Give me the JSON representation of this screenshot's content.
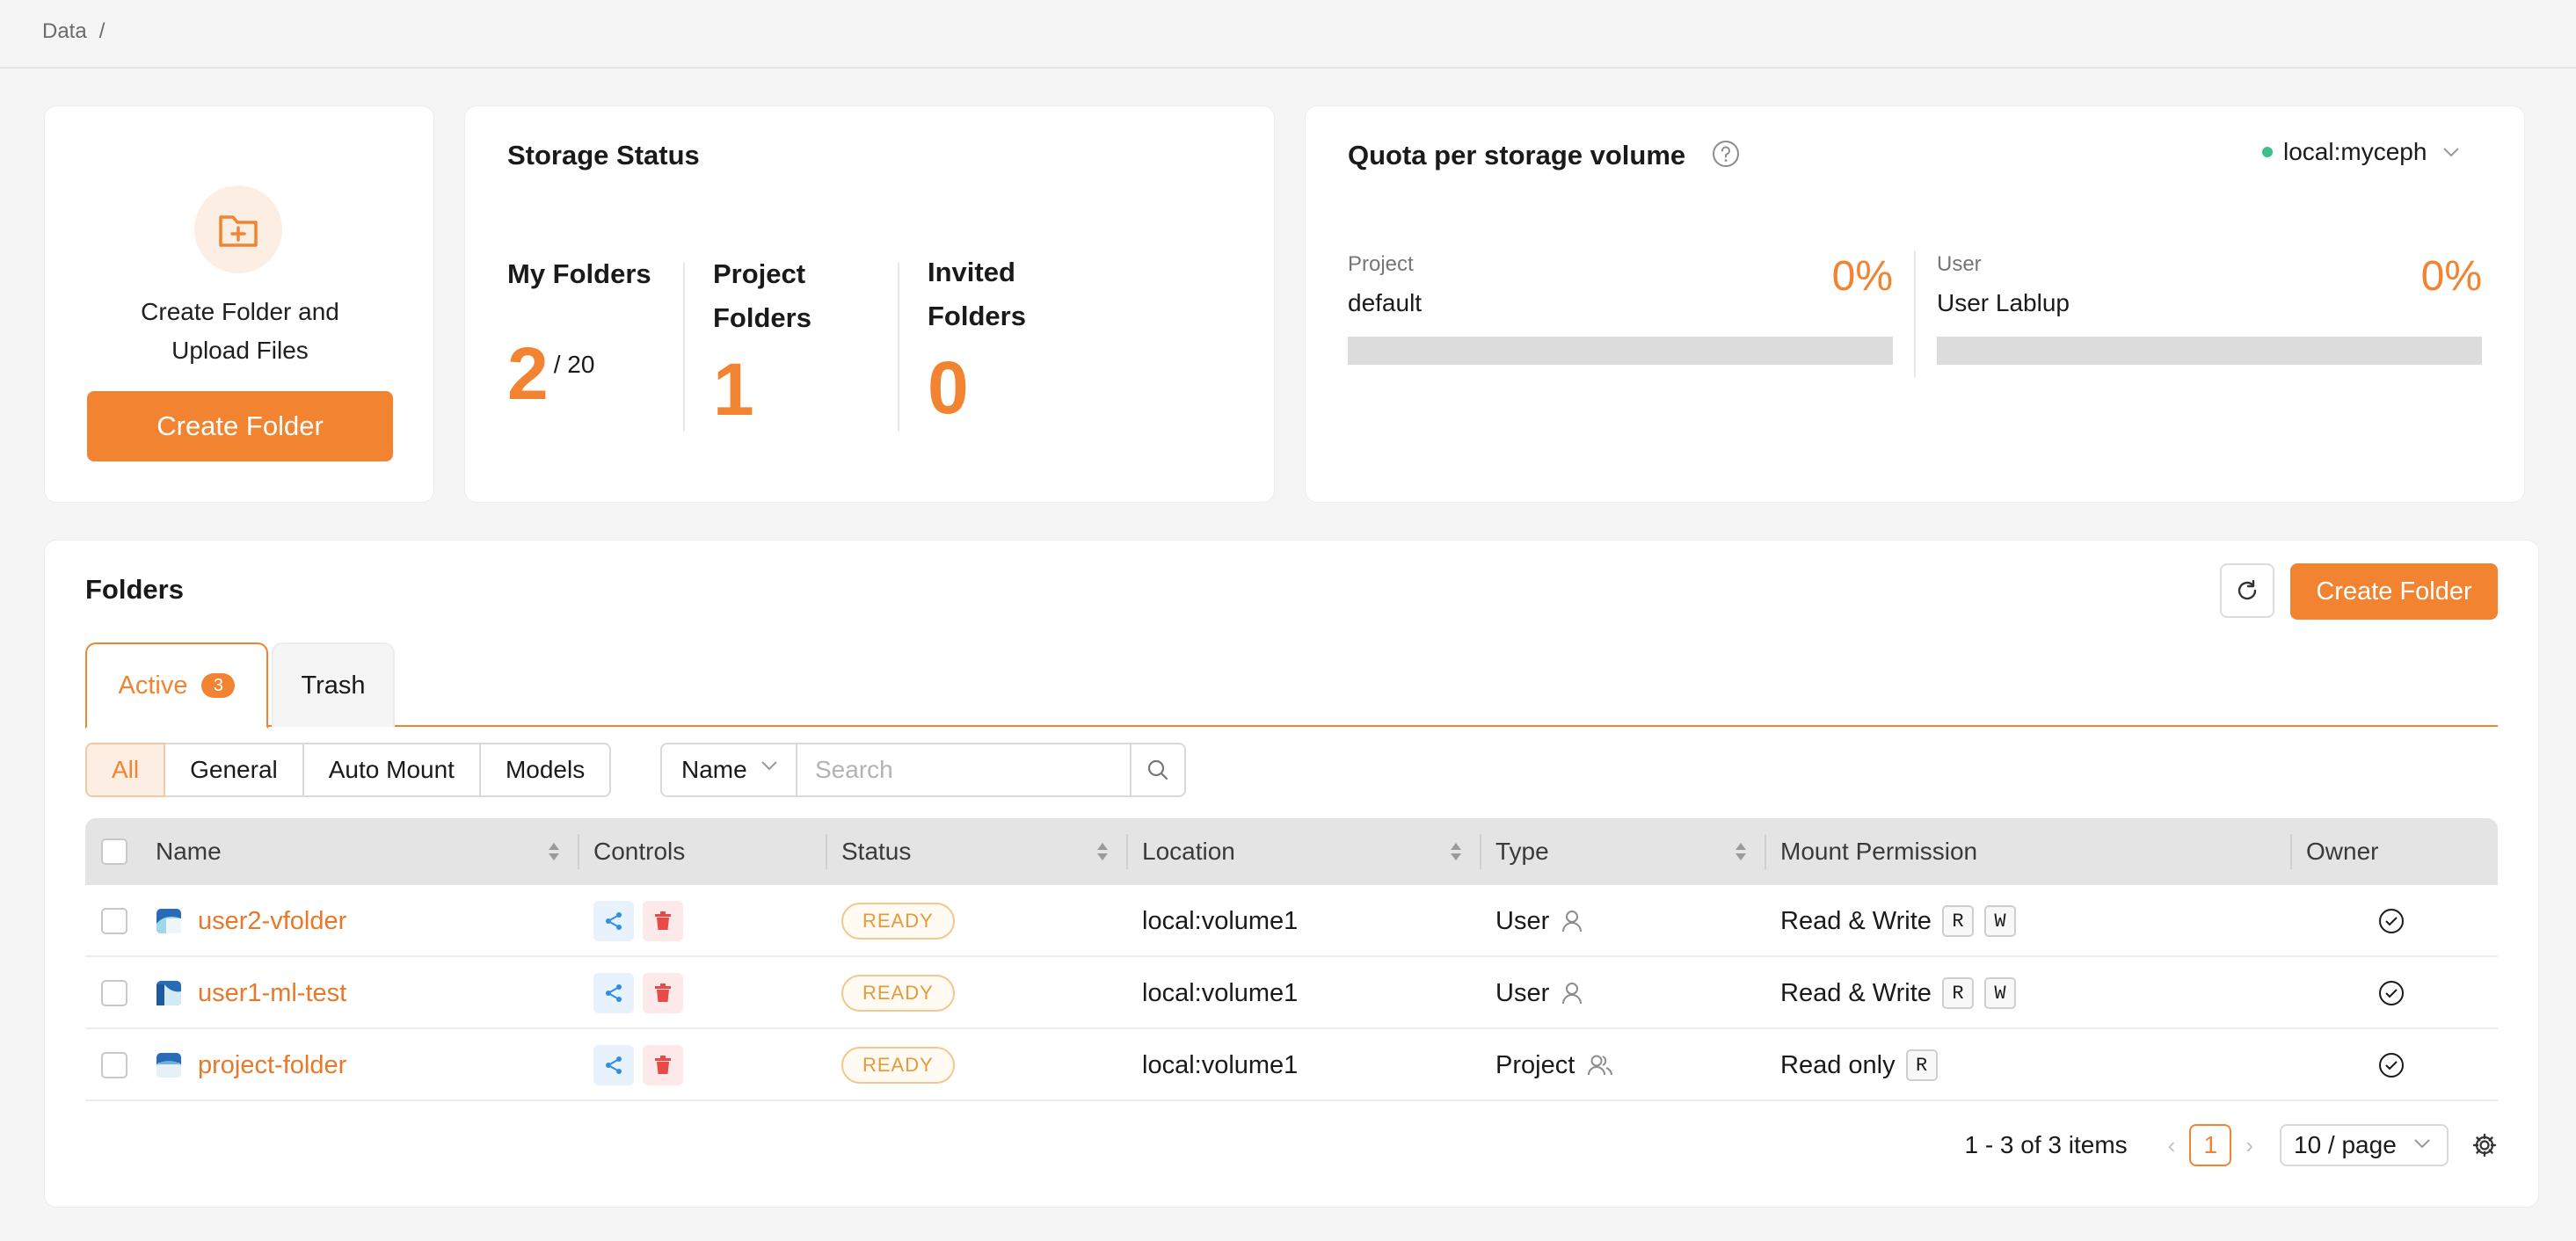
{
  "breadcrumb": {
    "root": "Data",
    "separator": "/"
  },
  "create_card": {
    "text_line1": "Create Folder and",
    "text_line2": "Upload Files",
    "button": "Create Folder",
    "icon": "folder-plus-icon"
  },
  "storage": {
    "title": "Storage Status",
    "my_folders": {
      "label_line1": "My Folders",
      "value": "2",
      "max": "/ 20"
    },
    "project_folders": {
      "label_line1": "Project",
      "label_line2": "Folders",
      "value": "1"
    },
    "invited_folders": {
      "label_line1": "Invited",
      "label_line2": "Folders",
      "value": "0"
    }
  },
  "quota": {
    "title": "Quota per storage volume",
    "volume": "local:myceph",
    "project": {
      "kind": "Project",
      "name": "default",
      "percent_label": "0%",
      "usage_fraction": 0
    },
    "user": {
      "kind": "User",
      "name": "User Lablup",
      "percent_label": "0%",
      "usage_fraction": 0
    }
  },
  "folders": {
    "title": "Folders",
    "create_button": "Create Folder",
    "tabs": [
      {
        "label": "Active",
        "count": "3"
      },
      {
        "label": "Trash"
      }
    ],
    "filters": [
      "All",
      "General",
      "Auto Mount",
      "Models"
    ],
    "search": {
      "field": "Name",
      "placeholder": "Search"
    },
    "columns": [
      "Name",
      "Controls",
      "Status",
      "Location",
      "Type",
      "Mount Permission",
      "Owner"
    ],
    "rows": [
      {
        "name": "user2-vfolder",
        "status": "READY",
        "location": "local:volume1",
        "type": "User",
        "permission": "Read & Write",
        "keys": [
          "R",
          "W"
        ]
      },
      {
        "name": "user1-ml-test",
        "status": "READY",
        "location": "local:volume1",
        "type": "User",
        "permission": "Read & Write",
        "keys": [
          "R",
          "W"
        ]
      },
      {
        "name": "project-folder",
        "status": "READY",
        "location": "local:volume1",
        "type": "Project",
        "permission": "Read only",
        "keys": [
          "R"
        ]
      }
    ],
    "pagination": {
      "info": "1 - 3 of 3 items",
      "current": "1",
      "page_size": "10 / page"
    }
  },
  "colors": {
    "accent": "#f28431",
    "ready": "#e69a3a",
    "share": "#2f8de4",
    "delete": "#e84a4a"
  }
}
